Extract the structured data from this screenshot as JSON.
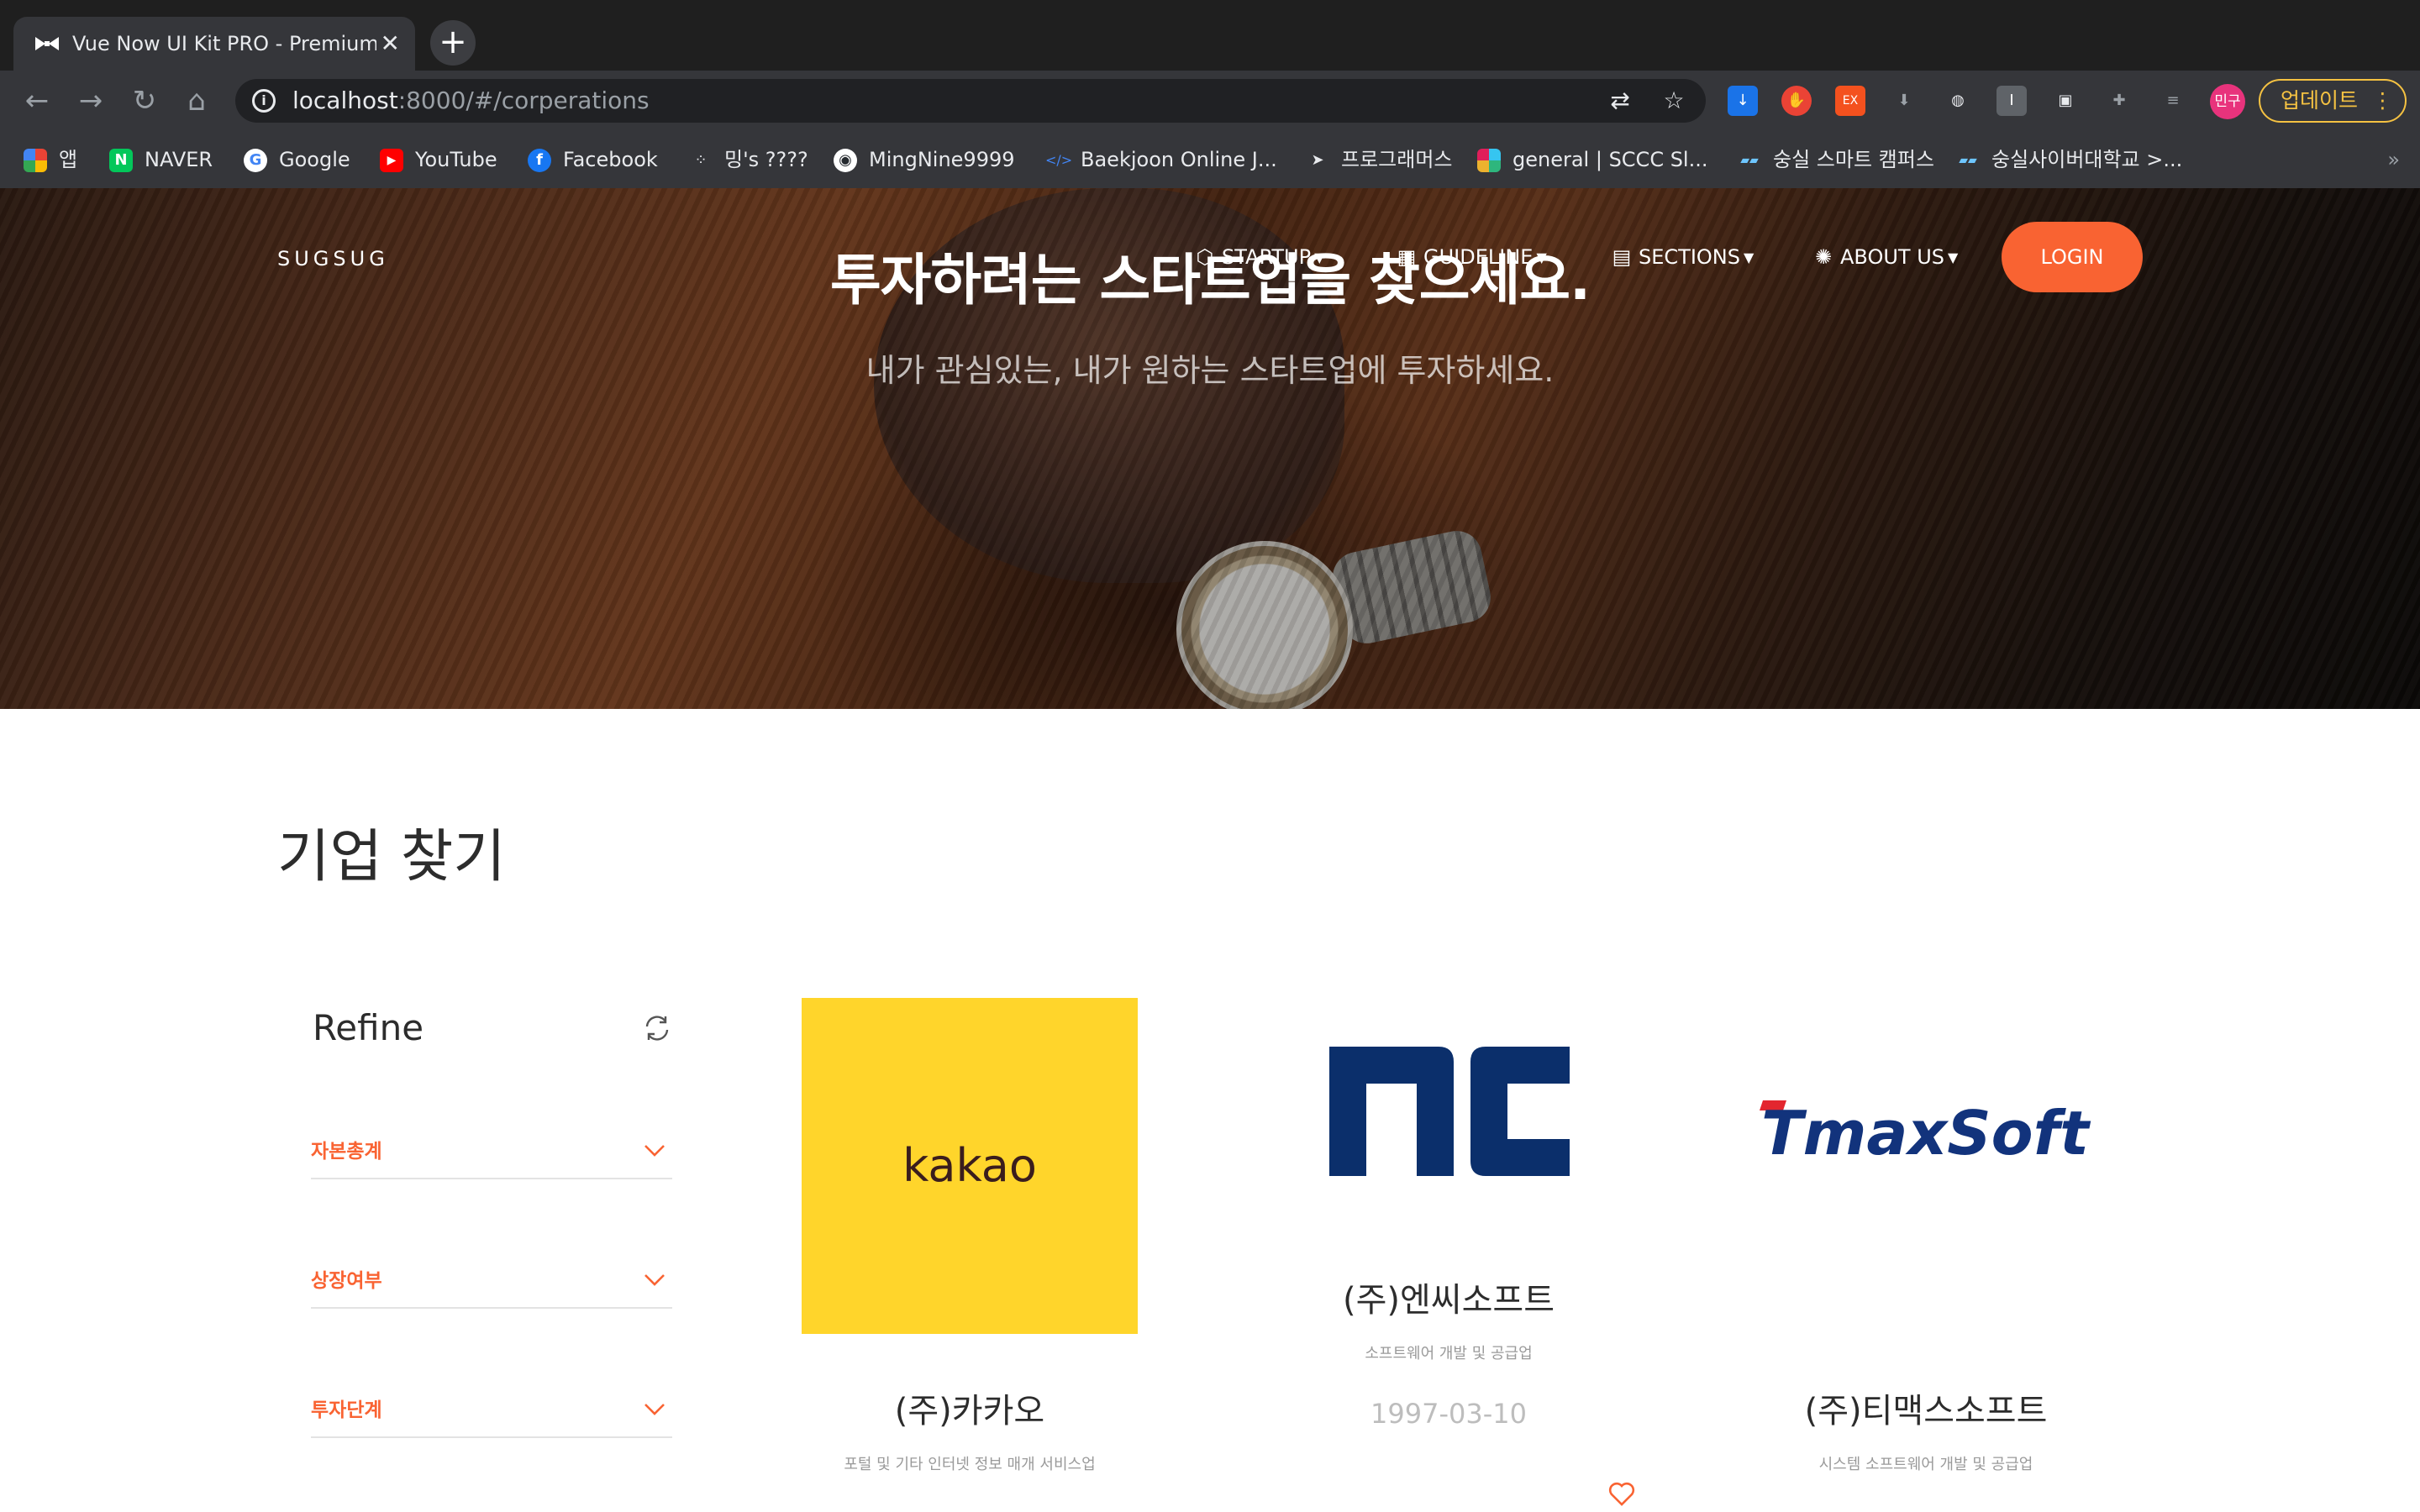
{
  "browser": {
    "tab_title": "Vue Now UI Kit PRO - Premium",
    "new_tab_symbol": "+",
    "close_symbol": "✕",
    "url_host": "localhost",
    "url_rest": ":8000/#/corperations",
    "profile_label": "민구",
    "update_label": "업데이트",
    "bookmarks": [
      {
        "label": "앱",
        "icon": "apps-grid-icon",
        "color": "#ea4335"
      },
      {
        "label": "NAVER",
        "icon": "naver-icon",
        "color": "#03c75a"
      },
      {
        "label": "Google",
        "icon": "google-icon",
        "color": "#ffffff"
      },
      {
        "label": "YouTube",
        "icon": "youtube-icon",
        "color": "#ff0000"
      },
      {
        "label": "Facebook",
        "icon": "facebook-icon",
        "color": "#1877f2"
      },
      {
        "label": "밍's ????",
        "icon": "dots-icon",
        "color": "#35363a"
      },
      {
        "label": "MingNine9999",
        "icon": "github-icon",
        "color": "#ffffff"
      },
      {
        "label": "Baekjoon Online J...",
        "icon": "code-icon",
        "color": "#35363a"
      },
      {
        "label": "프로그래머스",
        "icon": "programmers-icon",
        "color": "#35363a"
      },
      {
        "label": "general | SCCC Sl...",
        "icon": "slack-icon",
        "color": "#35363a"
      },
      {
        "label": "숭실 스마트 캠퍼스",
        "icon": "ssu-icon",
        "color": "#35363a"
      },
      {
        "label": "숭실사이버대학교 >...",
        "icon": "ssu-cyber-icon",
        "color": "#35363a"
      }
    ]
  },
  "navbar": {
    "brand": "SUGSUG",
    "items": [
      {
        "label": "STARTUP",
        "icon": "cube-icon"
      },
      {
        "label": "GUIDELINE",
        "icon": "building-icon"
      },
      {
        "label": "SECTIONS",
        "icon": "document-icon"
      },
      {
        "label": "ABOUT US",
        "icon": "bulb-icon"
      }
    ],
    "login": "LOGIN"
  },
  "hero": {
    "title": "투자하려는 스타트업을 찾으세요.",
    "subtitle": "내가 관심있는, 내가 원하는 스타트업에 투자하세요."
  },
  "main": {
    "title": "기업 찾기",
    "refine": {
      "title": "Refine",
      "filters": [
        "자본총계",
        "상장여부",
        "투자단계"
      ]
    },
    "companies": [
      {
        "name": "(주)카카오",
        "desc": "포털 및 기타 인터넷 정보 매개 서비스업",
        "logo_text": "kakao",
        "logo_color": "#ffd52b"
      },
      {
        "name": "(주)엔씨소프트",
        "desc": "소프트웨어 개발 및 공급업",
        "date": "1997-03-10",
        "logo_text": "nc",
        "logo_color": "#0b2f6b"
      },
      {
        "name": "(주)티맥스소프트",
        "desc": "시스템 소프트웨어 개발 및 공급업",
        "logo_text": "TmaxSoft",
        "logo_color": "#12337c"
      }
    ]
  },
  "colors": {
    "accent": "#f96332",
    "chrome_dark": "#202124"
  }
}
